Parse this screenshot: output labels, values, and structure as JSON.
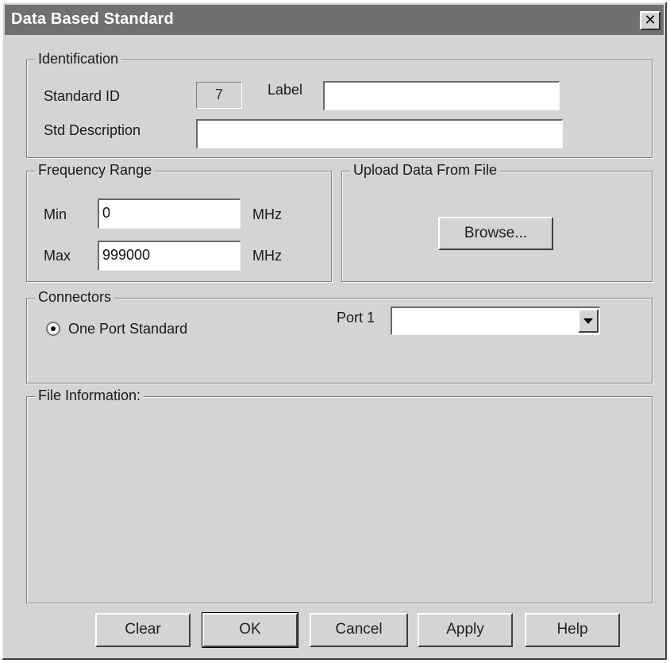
{
  "window": {
    "title": "Data Based Standard",
    "close_glyph": "✕"
  },
  "identification": {
    "legend": "Identification",
    "standard_id_label": "Standard ID",
    "standard_id_value": "7",
    "label_label": "Label",
    "label_value": "",
    "description_label": "Std Description",
    "description_value": ""
  },
  "frequency_range": {
    "legend": "Frequency Range",
    "min_label": "Min",
    "min_value": "0",
    "min_unit": "MHz",
    "max_label": "Max",
    "max_value": "999000",
    "max_unit": "MHz"
  },
  "upload": {
    "legend": "Upload Data From File",
    "browse_label": "Browse..."
  },
  "connectors": {
    "legend": "Connectors",
    "one_port_label": "One Port Standard",
    "one_port_selected": true,
    "port1_label": "Port 1",
    "port1_value": ""
  },
  "file_information": {
    "legend": "File Information:"
  },
  "buttons": {
    "clear": "Clear",
    "ok": "OK",
    "cancel": "Cancel",
    "apply": "Apply",
    "help": "Help"
  }
}
